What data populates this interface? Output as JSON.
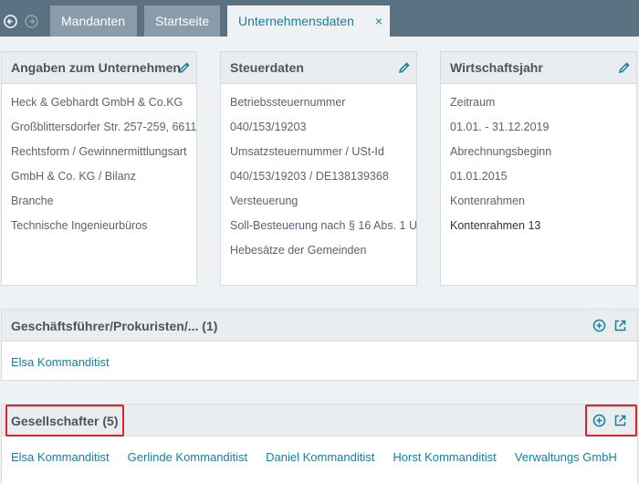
{
  "tabs": {
    "mandanten": "Mandanten",
    "startseite": "Startseite",
    "active": "Unternehmensdaten",
    "close": "×"
  },
  "cards": {
    "company": {
      "title": "Angaben zum Unternehmen",
      "rows": [
        "Heck & Gebhardt GmbH & Co.KG",
        "Großblittersdorfer Str.  257-259, 6611",
        "Rechtsform / Gewinnermittlungsart",
        "GmbH & Co. KG / Bilanz",
        "Branche",
        "Technische Ingenieurbüros"
      ]
    },
    "tax": {
      "title": "Steuerdaten",
      "rows": [
        "Betriebssteuernummer",
        "040/153/19203",
        "Umsatzsteuernummer / USt-Id",
        "040/153/19203 / DE138139368",
        "Versteuerung",
        "Soll-Besteuerung nach § 16 Abs. 1 U",
        "Hebesätze der Gemeinden"
      ]
    },
    "fiscal": {
      "title": "Wirtschaftsjahr",
      "rows": [
        "Zeitraum",
        "01.01. - 31.12.2019",
        "Abrechnungsbeginn",
        "01.01.2015",
        "Kontenrahmen",
        "Kontenrahmen 13"
      ]
    }
  },
  "sections": {
    "managers": {
      "title": "Geschäftsführer/Prokuristen/... (1)",
      "links": [
        "Elsa Kommanditist"
      ]
    },
    "partners": {
      "title": "Gesellschafter (5)",
      "links": [
        "Elsa Kommanditist",
        "Gerlinde Kommanditist",
        "Daniel Kommanditist",
        "Horst Kommanditist",
        "Verwaltungs GmbH"
      ]
    }
  },
  "colors": {
    "accent": "#1a7f99",
    "topbar": "#5b7283",
    "highlight": "#d9262a"
  }
}
